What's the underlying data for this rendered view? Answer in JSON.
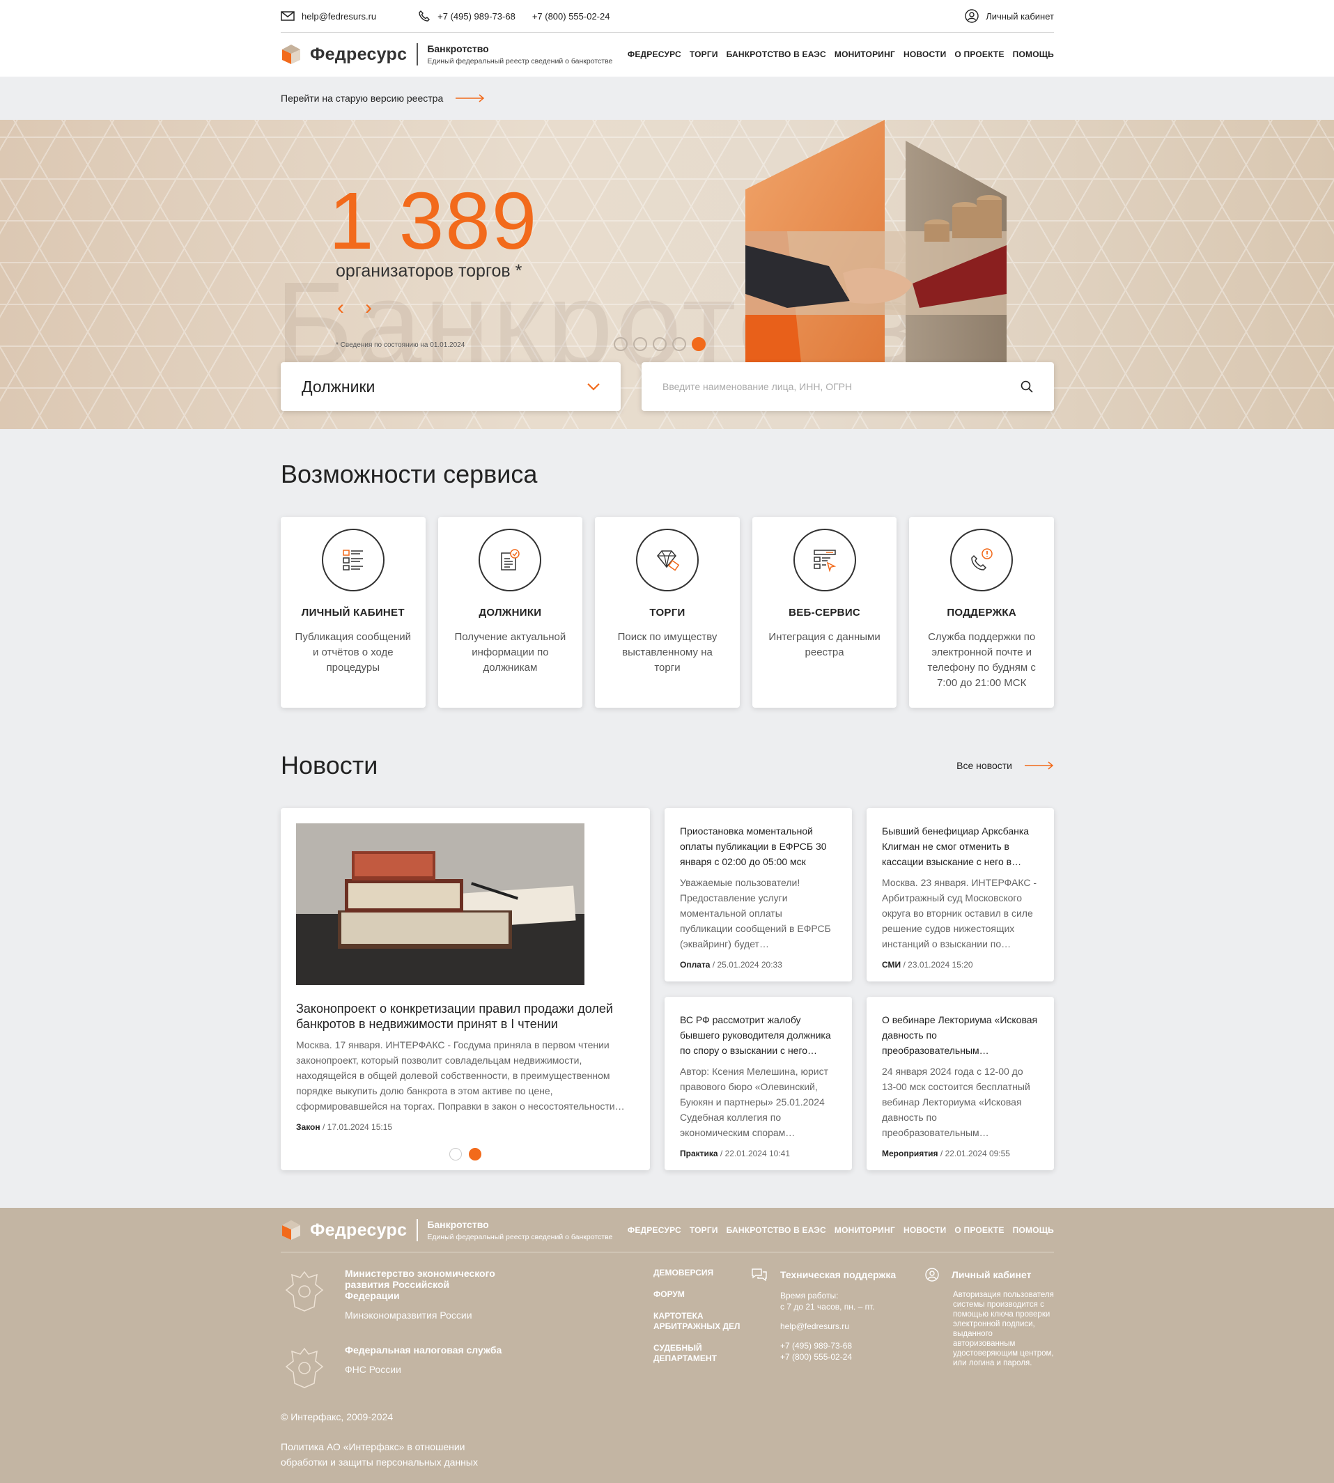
{
  "topbar": {
    "email": "help@fedresurs.ru",
    "phone1": "+7 (495) 989-73-68",
    "phone2": "+7 (800) 555-02-24",
    "cabinet": "Личный кабинет"
  },
  "header": {
    "brand": "Федресурс",
    "section": "Банкротство",
    "tagline": "Единый федеральный реестр сведений о банкротстве",
    "nav": [
      "ФЕДРЕСУРС",
      "ТОРГИ",
      "БАНКРОТСТВО В ЕАЭС",
      "МОНИТОРИНГ",
      "НОВОСТИ",
      "О ПРОЕКТЕ",
      "ПОМОЩЬ"
    ]
  },
  "old_version": "Перейти на старую версию реестра",
  "hero": {
    "watermark": "Банкротство",
    "count": "1 389",
    "caption": "организаторов торгов *",
    "note": "* Сведения по состоянию на 01.01.2024",
    "slides": 5,
    "active_slide": 5,
    "select_value": "Должники",
    "search_placeholder": "Введите наименование лица, ИНН, ОГРН"
  },
  "services": {
    "title": "Возможности сервиса",
    "cards": [
      {
        "title": "ЛИЧНЫЙ КАБИНЕТ",
        "desc": "Публикация сообщений и отчётов о ходе процедуры",
        "icon": "document-list-icon"
      },
      {
        "title": "ДОЛЖНИКИ",
        "desc": "Получение актуальной информации по должникам",
        "icon": "report-check-icon"
      },
      {
        "title": "ТОРГИ",
        "desc": "Поиск по имуществу выставленному на торги",
        "icon": "diamond-tag-icon"
      },
      {
        "title": "ВЕБ-СЕРВИС",
        "desc": "Интеграция с данными реестра",
        "icon": "web-form-icon"
      },
      {
        "title": "ПОДДЕРЖКА",
        "desc": "Служба поддержки по электронной почте и телефону по будням с 7:00 до 21:00 МСК",
        "icon": "phone-alert-icon"
      }
    ]
  },
  "news": {
    "title": "Новости",
    "all_link": "Все новости",
    "featured": {
      "title": "Законопроект о конкретизации правил продажи долей банкротов в недвижимости принят в I чтении",
      "text": "Москва. 17 января. ИНТЕРФАКС - Госдума приняла в первом чтении законопроект, который позволит совладельцам недвижимости, находящейся в общей долевой собственности, в преимущественном порядке выкупить долю банкрота в этом активе по цене, сформировавшейся на торгах. Поправки в закон о несостоятельности…",
      "category": "Закон",
      "date": "17.01.2024 15:15",
      "pages": 2,
      "active_page": 2
    },
    "items": [
      {
        "title": "Приостановка моментальной оплаты публикации в ЕФРСБ 30 января с 02:00 до 05:00 мск",
        "text": "Уважаемые пользователи! Предоставление услуги моментальной оплаты публикации сообщений в ЕФРСБ (эквайринг) будет…",
        "category": "Оплата",
        "date": "25.01.2024 20:33"
      },
      {
        "title": "Бывший бенефициар Арксбанка Клигман не смог отменить в кассации взыскание с него в…",
        "text": "Москва. 23 января. ИНТЕРФАКС - Арбитражный суд Московского округа во вторник оставил в силе решение судов нижестоящих инстанций о взыскании по…",
        "category": "СМИ",
        "date": "23.01.2024 15:20"
      },
      {
        "title": "ВС РФ рассмотрит жалобу бывшего руководителя должника по спору о взыскании с него…",
        "text": "Автор: Ксения Мелешина, юрист правового бюро «Олевинский, Буюкян и партнеры» 25.01.2024 Судебная коллегия по экономическим спорам…",
        "category": "Практика",
        "date": "22.01.2024 10:41"
      },
      {
        "title": "О вебинаре Лекториума «Исковая давность по преобразовательным…",
        "text": "24 января 2024 года с 12-00 до 13-00 мск состоится бесплатный вебинар Лекториума «Исковая давность по преобразовательным…",
        "category": "Мероприятия",
        "date": "22.01.2024 09:55"
      }
    ]
  },
  "footer": {
    "orgs": [
      {
        "name": "Министерство экономического развития Российской Федерации",
        "short": "Минэкономразвития России"
      },
      {
        "name": "Федеральная налоговая служба",
        "short": "ФНС России"
      }
    ],
    "links": [
      "ДЕМОВЕРСИЯ",
      "ФОРУМ",
      "КАРТОТЕКА АРБИТРАЖНЫХ ДЕЛ",
      "СУДЕБНЫЙ ДЕПАРТАМЕНТ"
    ],
    "support": {
      "title": "Техническая поддержка",
      "hours_label": "Время работы:",
      "hours": "с 7 до 21 часов, пн. – пт.",
      "email": "help@fedresurs.ru",
      "phone1": "+7 (495) 989-73-68",
      "phone2": "+7 (800) 555-02-24"
    },
    "cabinet": {
      "title": "Личный кабинет",
      "text": "Авторизация пользователя системы производится с помощью ключа проверки электронной подписи, выданного авторизованным удостоверяющим центром, или логина и пароля."
    },
    "copyright": "© Интерфакс, 2009-2024",
    "policy": "Политика АО «Интерфакс» в отношении обработки и защиты персональных данных"
  },
  "colors": {
    "accent": "#f26a1b",
    "footer_bg": "#c3b5a3",
    "page_bg": "#edeef0"
  }
}
